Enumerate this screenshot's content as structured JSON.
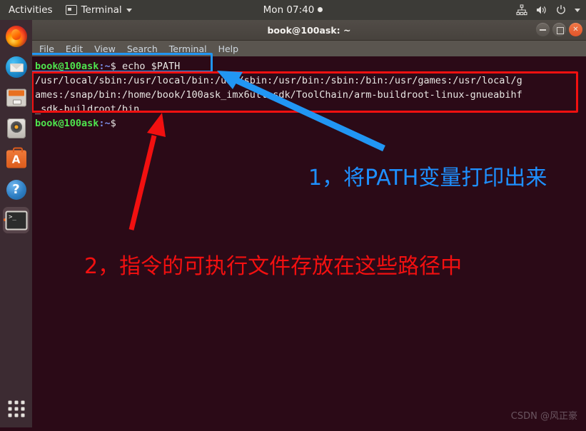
{
  "top_panel": {
    "activities": "Activities",
    "app_menu": {
      "label": "Terminal",
      "icon": "terminal-icon",
      "caret": "chevron-down-icon"
    },
    "clock": "Mon 07:40",
    "tray": [
      {
        "name": "network-icon",
        "label": "network"
      },
      {
        "name": "volume-icon",
        "label": "volume"
      },
      {
        "name": "power-icon",
        "label": "power"
      },
      {
        "name": "chevron-down-icon",
        "label": "system-menu"
      }
    ]
  },
  "dock": {
    "items": [
      {
        "name": "firefox",
        "label": "Firefox Web Browser",
        "active": false
      },
      {
        "name": "thunderbird",
        "label": "Thunderbird Mail",
        "active": false
      },
      {
        "name": "files",
        "label": "Files",
        "active": false
      },
      {
        "name": "rhythmbox",
        "label": "Rhythmbox",
        "active": false
      },
      {
        "name": "ubuntu-software",
        "label": "Ubuntu Software",
        "active": false
      },
      {
        "name": "help",
        "label": "Help",
        "active": false
      },
      {
        "name": "terminal",
        "label": "Terminal",
        "active": true
      }
    ],
    "show_apps_label": "Show Applications"
  },
  "window": {
    "title": "book@100ask: ~",
    "buttons": {
      "minimize": "minimize",
      "maximize": "maximize",
      "close": "close"
    },
    "menu": [
      {
        "label": "File"
      },
      {
        "label": "Edit"
      },
      {
        "label": "View"
      },
      {
        "label": "Search"
      },
      {
        "label": "Terminal"
      },
      {
        "label": "Help"
      }
    ]
  },
  "terminal": {
    "prompt_user": "book@100ask",
    "prompt_path": ":~",
    "prompt_symbol": "$ ",
    "command": "echo $PATH",
    "output_lines": [
      "/usr/local/sbin:/usr/local/bin:/usr/sbin:/usr/bin:/sbin:/bin:/usr/games:/usr/local/g",
      "ames:/snap/bin:/home/book/100ask_imx6ull-sdk/ToolChain/arm-buildroot-linux-gnueabihf",
      "_sdk-buildroot/bin"
    ]
  },
  "annotations": {
    "note_1": "1，将PATH变量打印出来",
    "note_2": "2，指令的可执行文件存放在这些路径中",
    "blue_color": "#2196f3",
    "red_color": "#f21010"
  },
  "watermark": "CSDN @风正豪"
}
